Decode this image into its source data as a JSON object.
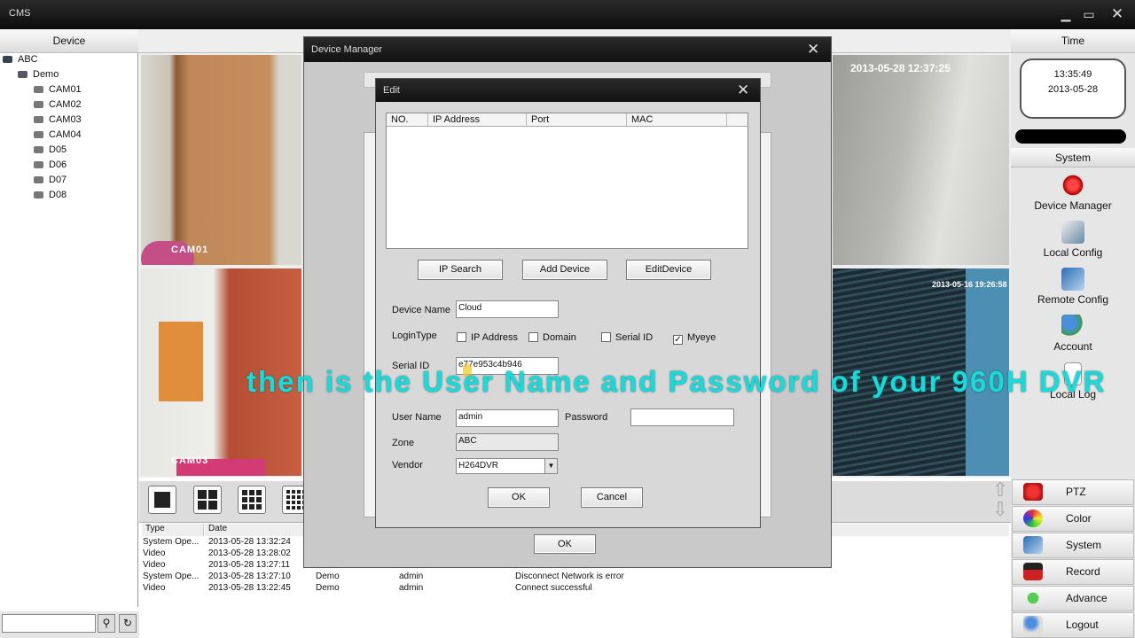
{
  "app": {
    "title": "CMS"
  },
  "header": {
    "device": "Device",
    "time": "Time"
  },
  "tree": {
    "root": "ABC",
    "group": "Demo",
    "cams": [
      "CAM01",
      "CAM02",
      "CAM03",
      "CAM04",
      "D05",
      "D06",
      "D07",
      "D08"
    ]
  },
  "video": {
    "cam01": "CAM01",
    "cam03": "CAM03",
    "ts_top": "2013-05-28 12:37:25",
    "ts_right": "2013-05-16 19:26:58"
  },
  "clock": {
    "time": "13:35:49",
    "date": "2013-05-28"
  },
  "system_header": "System",
  "side_menu": [
    "Device Manager",
    "Local Config",
    "Remote Config",
    "Account",
    "Local Log"
  ],
  "bottom_menu": [
    "PTZ",
    "Color",
    "System",
    "Record",
    "Advance",
    "Logout"
  ],
  "log": {
    "headers": [
      "Type",
      "Date"
    ],
    "rows": [
      [
        "System Ope...",
        "2013-05-28 13:32:24",
        "",
        "",
        ""
      ],
      [
        "Video",
        "2013-05-28 13:28:02",
        "",
        "",
        ""
      ],
      [
        "Video",
        "2013-05-28 13:27:11",
        "Demo",
        "admin",
        "Connect successful"
      ],
      [
        "System Ope...",
        "2013-05-28 13:27:10",
        "Demo",
        "admin",
        "Disconnect Network is error"
      ],
      [
        "Video",
        "2013-05-28 13:22:45",
        "Demo",
        "admin",
        "Connect successful"
      ]
    ]
  },
  "device_manager": {
    "title": "Device Manager",
    "ok": "OK"
  },
  "edit": {
    "title": "Edit",
    "columns": [
      "NO.",
      "IP Address",
      "Port",
      "MAC"
    ],
    "buttons": {
      "ip_search": "IP Search",
      "add_device": "Add Device",
      "edit_device": "EditDevice",
      "ok": "OK",
      "cancel": "Cancel"
    },
    "labels": {
      "device_name": "Device Name",
      "login_type": "LoginType",
      "serial_id": "Serial ID",
      "user_name": "User Name",
      "password": "Password",
      "zone": "Zone",
      "vendor": "Vendor"
    },
    "values": {
      "device_name": "Cloud",
      "serial_id": "e77e953c4b946",
      "user_name": "admin",
      "password": "",
      "zone": "ABC",
      "vendor": "H264DVR"
    },
    "login_options": [
      {
        "label": "IP Address",
        "checked": false
      },
      {
        "label": "Domain",
        "checked": false
      },
      {
        "label": "Serial ID",
        "checked": false
      },
      {
        "label": "Myeye",
        "checked": true
      }
    ]
  },
  "overlay_caption": "then is the User Name and Password of your 960H DVR"
}
